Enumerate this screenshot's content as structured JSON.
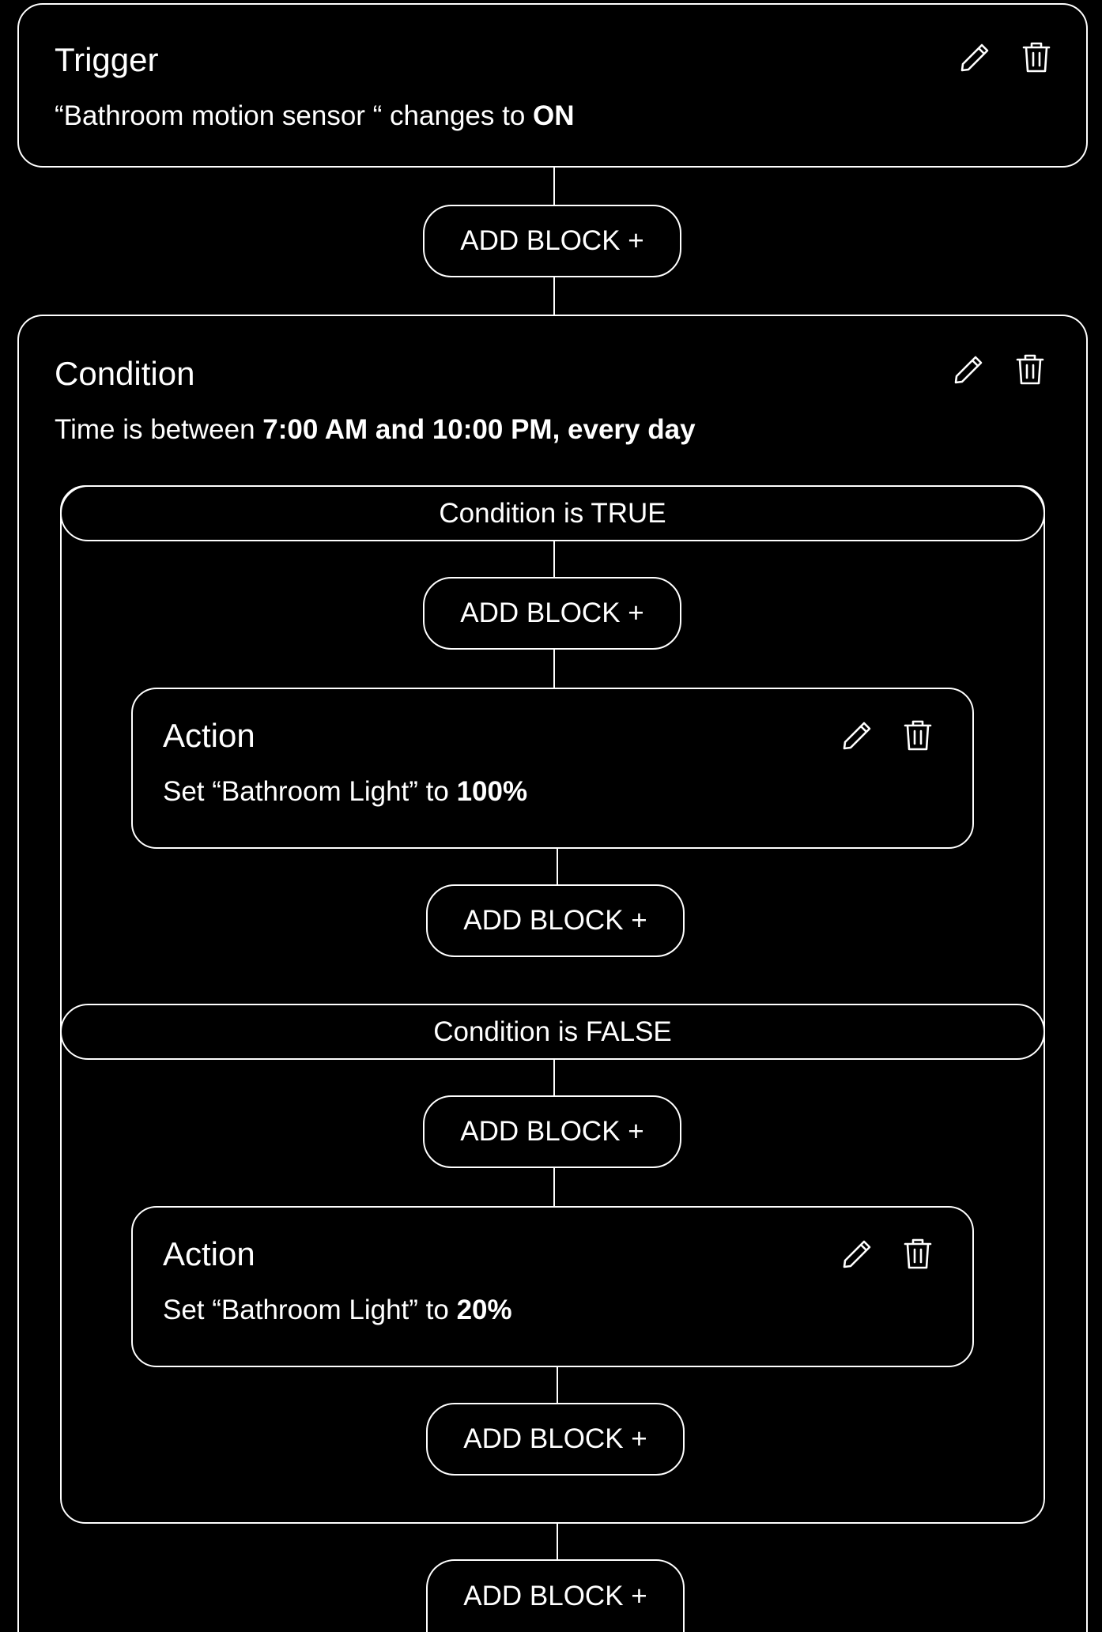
{
  "trigger": {
    "title": "Trigger",
    "desc_prefix": "“Bathroom motion sensor “ changes to ",
    "desc_bold": "ON",
    "edit_icon": "pencil-icon",
    "delete_icon": "trash-icon"
  },
  "add_block_label": "ADD BLOCK +",
  "condition": {
    "title": "Condition",
    "desc_prefix": "Time is between ",
    "desc_bold": "7:00 AM and 10:00 PM, every day",
    "edit_icon": "pencil-icon",
    "delete_icon": "trash-icon",
    "true_branch": {
      "label": "Condition is TRUE",
      "action": {
        "title": "Action",
        "desc_prefix": "Set “Bathroom Light” to ",
        "desc_bold": "100%"
      }
    },
    "false_branch": {
      "label": "Condition is FALSE",
      "action": {
        "title": "Action",
        "desc_prefix": "Set “Bathroom Light” to ",
        "desc_bold": "20%"
      }
    }
  },
  "colors": {
    "background": "#000000",
    "foreground": "#ffffff"
  }
}
